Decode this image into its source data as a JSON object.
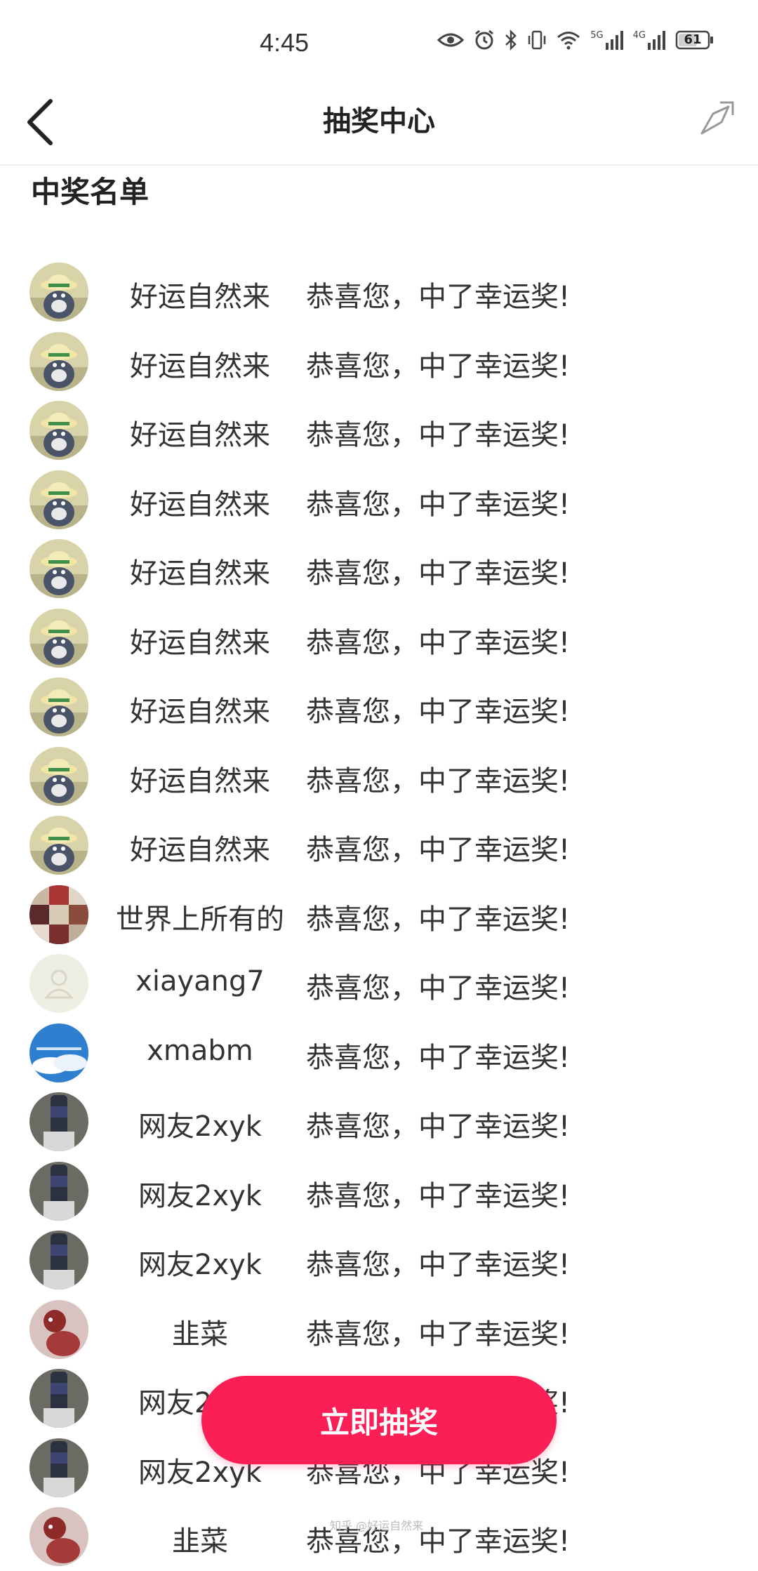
{
  "status_bar": {
    "time": "4:45",
    "battery": "61",
    "net1": "5G",
    "net2": "4G"
  },
  "header": {
    "title": "抽奖中心"
  },
  "section": {
    "title": "中奖名单"
  },
  "winners": [
    {
      "name": "好运自然来",
      "message": "恭喜您，中了幸运奖!",
      "avatar": "cartoon-cat-avatar"
    },
    {
      "name": "好运自然来",
      "message": "恭喜您，中了幸运奖!",
      "avatar": "cartoon-cat-avatar"
    },
    {
      "name": "好运自然来",
      "message": "恭喜您，中了幸运奖!",
      "avatar": "cartoon-cat-avatar"
    },
    {
      "name": "好运自然来",
      "message": "恭喜您，中了幸运奖!",
      "avatar": "cartoon-cat-avatar"
    },
    {
      "name": "好运自然来",
      "message": "恭喜您，中了幸运奖!",
      "avatar": "cartoon-cat-avatar"
    },
    {
      "name": "好运自然来",
      "message": "恭喜您，中了幸运奖!",
      "avatar": "cartoon-cat-avatar"
    },
    {
      "name": "好运自然来",
      "message": "恭喜您，中了幸运奖!",
      "avatar": "cartoon-cat-avatar"
    },
    {
      "name": "好运自然来",
      "message": "恭喜您，中了幸运奖!",
      "avatar": "cartoon-cat-avatar"
    },
    {
      "name": "好运自然来",
      "message": "恭喜您，中了幸运奖!",
      "avatar": "cartoon-cat-avatar"
    },
    {
      "name": "世界上所有的",
      "message": "恭喜您，中了幸运奖!",
      "avatar": "collage-avatar"
    },
    {
      "name": "xiayang7",
      "message": "恭喜您，中了幸运奖!",
      "avatar": "default-user-avatar"
    },
    {
      "name": "xmabm",
      "message": "恭喜您，中了幸运奖!",
      "avatar": "sky-cloud-avatar"
    },
    {
      "name": "网友2xyk",
      "message": "恭喜您，中了幸运奖!",
      "avatar": "bottle-avatar"
    },
    {
      "name": "网友2xyk",
      "message": "恭喜您，中了幸运奖!",
      "avatar": "bottle-avatar"
    },
    {
      "name": "网友2xyk",
      "message": "恭喜您，中了幸运奖!",
      "avatar": "bottle-avatar"
    },
    {
      "name": "韭菜",
      "message": "恭喜您，中了幸运奖!",
      "avatar": "red-figure-avatar"
    },
    {
      "name": "网友2xyk",
      "message": "恭喜您，中了幸运奖!",
      "avatar": "bottle-avatar"
    },
    {
      "name": "网友2xyk",
      "message": "恭喜您，中了幸运奖!",
      "avatar": "bottle-avatar"
    },
    {
      "name": "韭菜",
      "message": "恭喜您，中了幸运奖!",
      "avatar": "red-figure-avatar"
    }
  ],
  "cta": {
    "label": "立即抽奖",
    "color": "#fb1f55"
  },
  "watermark": "知乎 @好运自然来"
}
